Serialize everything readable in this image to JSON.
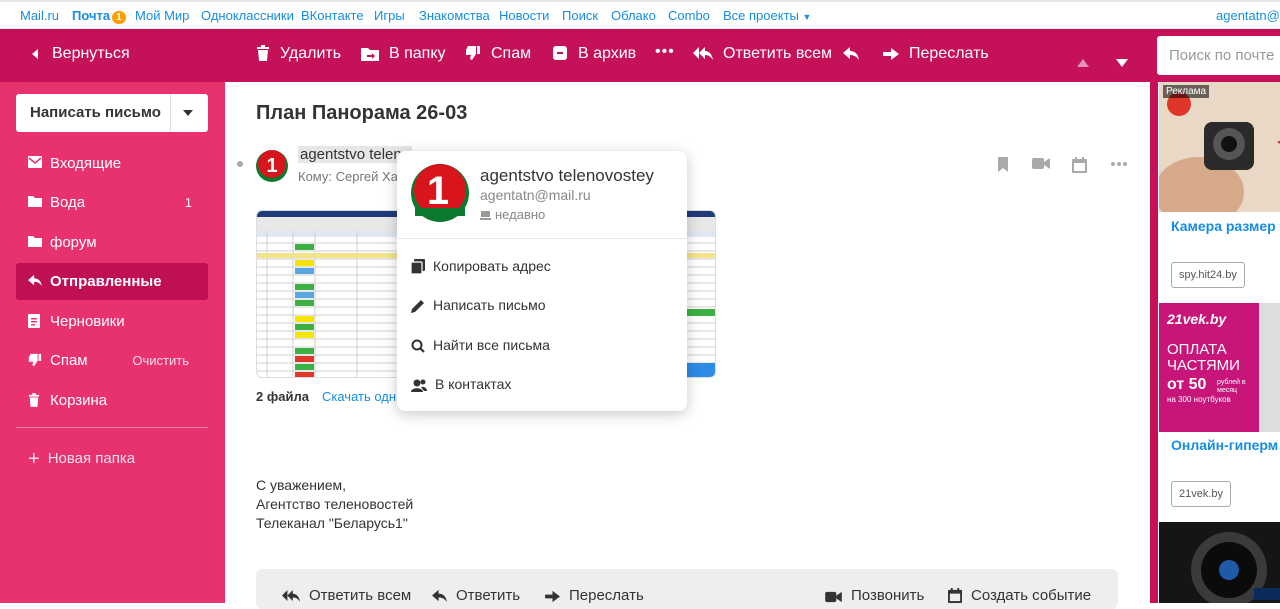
{
  "topnav": {
    "links": [
      "Mail.ru",
      "Почта",
      "Мой Мир",
      "Одноклассники",
      "ВКонтакте",
      "Игры",
      "Знакомства",
      "Новости",
      "Поиск",
      "Облако",
      "Combo",
      "Все проекты"
    ],
    "mail_badge": "1",
    "user": "agentatn@"
  },
  "toolbar": {
    "back": "Вернуться",
    "delete": "Удалить",
    "to_folder": "В папку",
    "spam": "Спам",
    "archive": "В архив",
    "more": "•••",
    "reply_all": "Ответить всем",
    "forward": "Переслать",
    "search_placeholder": "Поиск по почте"
  },
  "sidebar": {
    "compose": "Написать письмо",
    "folders": [
      {
        "name": "Входящие",
        "count": "",
        "action": ""
      },
      {
        "name": "Вода",
        "count": "1",
        "action": ""
      },
      {
        "name": "форум",
        "count": "",
        "action": ""
      },
      {
        "name": "Отправленные",
        "count": "",
        "action": ""
      },
      {
        "name": "Черновики",
        "count": "",
        "action": ""
      },
      {
        "name": "Спам",
        "count": "",
        "action": "Очистить"
      },
      {
        "name": "Корзина",
        "count": "",
        "action": ""
      }
    ],
    "new_folder": "Новая папка"
  },
  "message": {
    "subject": "План Панорама 26-03",
    "sender": "agentstvo teleno",
    "to": "Кому: Сергей Ха",
    "files_count": "2 файла",
    "download": "Скачать одн",
    "signature": [
      "С уважением,",
      "Агентство теленовостей",
      "Телеканал \"Беларусь1\""
    ],
    "reply_bar": {
      "reply_all": "Ответить всем",
      "reply": "Ответить",
      "forward": "Переслать",
      "call": "Позвонить",
      "event": "Создать событие"
    }
  },
  "popup": {
    "name": "agentstvo telenovostey",
    "email": "agentatn@mail.ru",
    "seen": "недавно",
    "items": [
      "Копировать адрес",
      "Написать письмо",
      "Найти все письма",
      "В контактах"
    ]
  },
  "ads": {
    "label": "Реклама",
    "ad1": {
      "title": "Камера размер",
      "link": "spy.hit24.by"
    },
    "ad2": {
      "brand": "21vek.by",
      "lines": [
        "ОПЛАТА",
        "ЧАСТЯМИ"
      ],
      "promo_big": "от 50",
      "promo_small": "рублей в месяц",
      "promo_note": "на 300 ноутбуков",
      "title": "Онлайн-гиперм",
      "link": "21vek.by"
    }
  },
  "colors": {
    "toolbar": "#c5115a",
    "sidebar": "#e7326e",
    "active_folder": "#bf0f55",
    "link": "#168de2"
  }
}
